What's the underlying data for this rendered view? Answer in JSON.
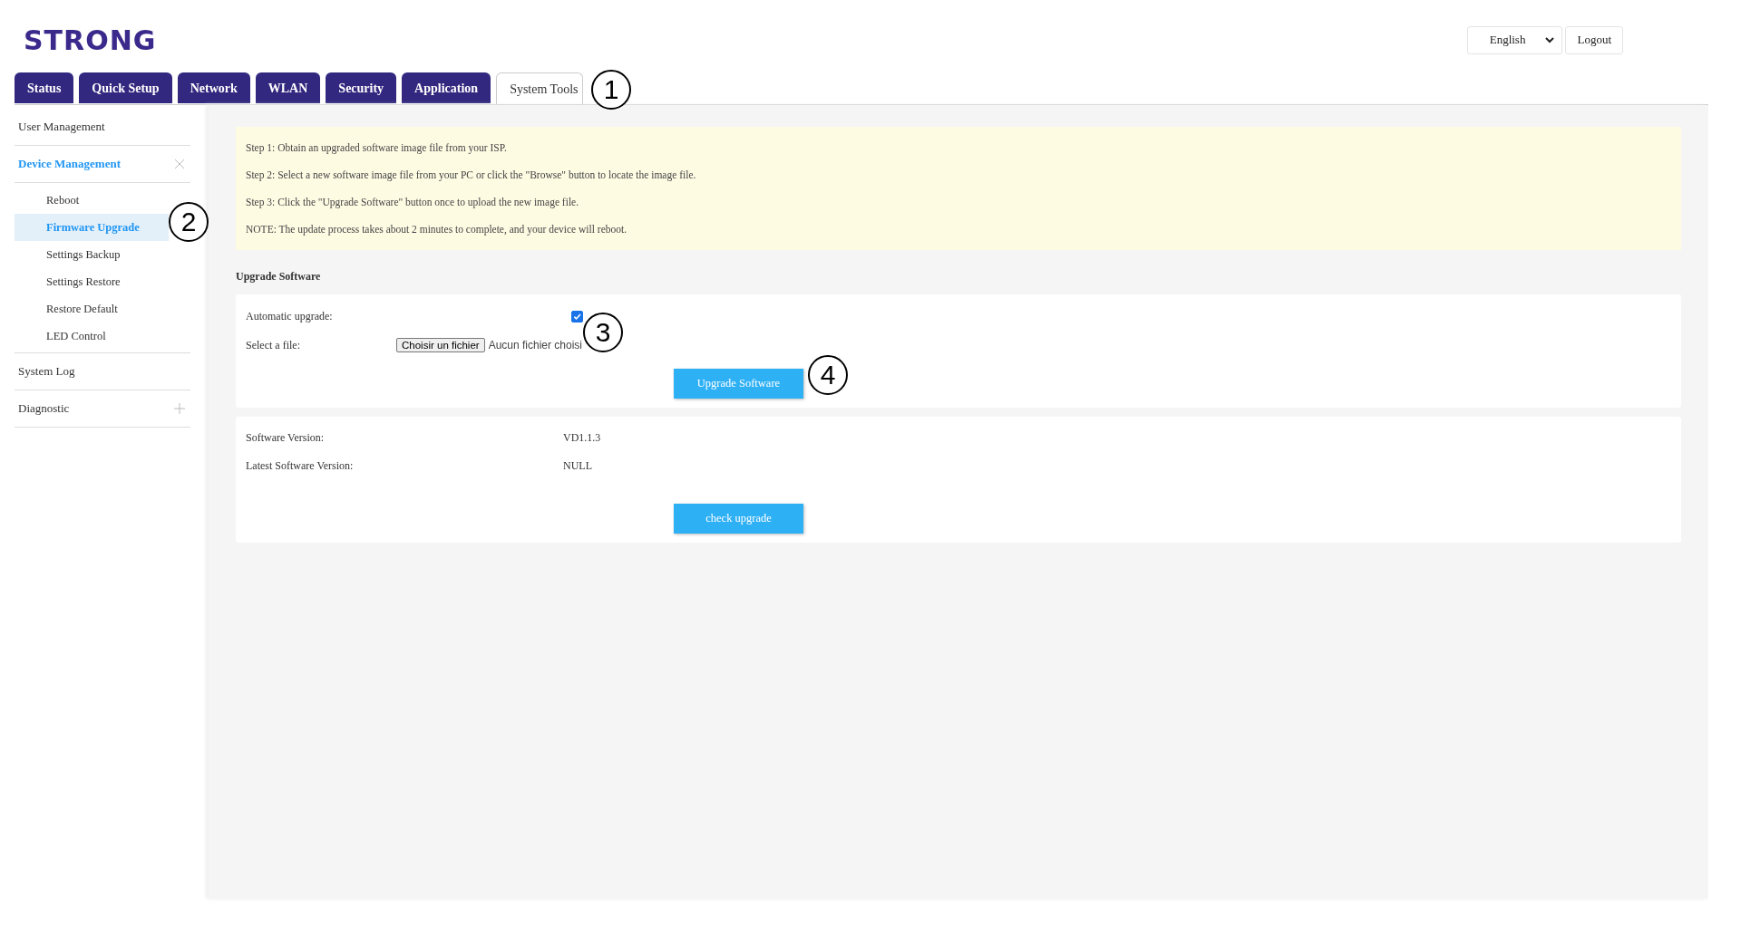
{
  "logo": {
    "text": "STRONG"
  },
  "header": {
    "language": "English",
    "logout": "Logout"
  },
  "tabs": [
    {
      "label": "Status",
      "selected": false
    },
    {
      "label": "Quick Setup",
      "selected": false
    },
    {
      "label": "Network",
      "selected": false
    },
    {
      "label": "WLAN",
      "selected": false
    },
    {
      "label": "Security",
      "selected": false
    },
    {
      "label": "Application",
      "selected": false
    },
    {
      "label": "System Tools",
      "selected": true
    }
  ],
  "sidebar": {
    "items": [
      {
        "label": "User Management",
        "kind": "link",
        "selected": false
      },
      {
        "label": "Device Management",
        "kind": "group",
        "expanded": true,
        "selected": true,
        "children": [
          {
            "label": "Reboot",
            "selected": false
          },
          {
            "label": "Firmware Upgrade",
            "selected": true
          },
          {
            "label": "Settings Backup",
            "selected": false
          },
          {
            "label": "Settings Restore",
            "selected": false
          },
          {
            "label": "Restore Default",
            "selected": false
          },
          {
            "label": "LED Control",
            "selected": false
          }
        ]
      },
      {
        "label": "System Log",
        "kind": "link",
        "selected": false
      },
      {
        "label": "Diagnostic",
        "kind": "group",
        "expanded": false,
        "selected": false
      }
    ]
  },
  "instructions": [
    "Step 1: Obtain an upgraded software image file from your ISP.",
    "Step 2: Select a new software image file from your PC or click the \"Browse\" button to locate the image file.",
    "Step 3: Click the \"Upgrade Software\" button once to upload the new image file.",
    "NOTE: The update process takes about 2 minutes to complete, and your device will reboot."
  ],
  "section_title": "Upgrade Software",
  "upgrade_form": {
    "automatic_label": "Automatic upgrade:",
    "automatic_checked": true,
    "file_label": "Select a file:",
    "file_button": "Choisir un fichier",
    "file_status": "Aucun fichier choisi",
    "submit": "Upgrade Software"
  },
  "version_info": {
    "rows": [
      {
        "label": "Software Version:",
        "value": "VD1.1.3"
      },
      {
        "label": "Latest Software Version:",
        "value": "NULL"
      }
    ],
    "button": "check upgrade"
  },
  "callouts": [
    "1",
    "2",
    "3",
    "4"
  ]
}
